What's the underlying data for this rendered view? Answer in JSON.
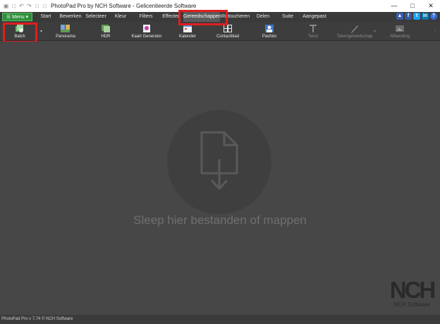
{
  "window": {
    "title": "PhotoPad Pro by NCH Software - Gelicentieerde Software",
    "minimize": "—",
    "maximize": "□",
    "close": "✕"
  },
  "menu": {
    "label": "Menu",
    "arrow": "▾",
    "hamburger": "☰"
  },
  "tabs": [
    {
      "label": "Start"
    },
    {
      "label": "Bewerken"
    },
    {
      "label": "Selecteer"
    },
    {
      "label": "Kleur"
    },
    {
      "label": "Filters"
    },
    {
      "label": "Effecten"
    },
    {
      "label": "Gereedschappen"
    },
    {
      "label": "Retoucheren"
    },
    {
      "label": "Delen"
    },
    {
      "label": "Suite"
    },
    {
      "label": "Aangepast"
    }
  ],
  "active_tab": "Gereedschappen",
  "social": [
    "thumbs-up-icon",
    "facebook-icon",
    "twitter-icon",
    "linkedin-icon",
    "help-icon"
  ],
  "tools": [
    {
      "label": "Batch",
      "icon": "batch-icon"
    },
    {
      "label": "Panorama",
      "icon": "panorama-icon"
    },
    {
      "label": "HDR",
      "icon": "hdr-icon"
    },
    {
      "label": "Kaart Generator",
      "icon": "card-generator-icon"
    },
    {
      "label": "Kalender",
      "icon": "calendar-icon"
    },
    {
      "label": "Contactblad",
      "icon": "contact-sheet-icon"
    },
    {
      "label": "Pasfoto",
      "icon": "passport-photo-icon"
    },
    {
      "label": "Tekst",
      "icon": "text-icon",
      "disabled": true
    },
    {
      "label": "Tekengereedschap",
      "icon": "draw-tool-icon",
      "disabled": true
    },
    {
      "label": "Afbeelding",
      "icon": "image-icon",
      "disabled": true
    }
  ],
  "dropzone": {
    "text": "Sleep hier bestanden of mappen"
  },
  "branding": {
    "logo": "NCH",
    "subtitle": "NCH Software"
  },
  "status": {
    "text": "PhotoPad Pro v 7.74 © NCH Software"
  },
  "colors": {
    "accent_green": "#2f8f3b",
    "highlight_red": "#e01e1e",
    "background": "#474747"
  }
}
